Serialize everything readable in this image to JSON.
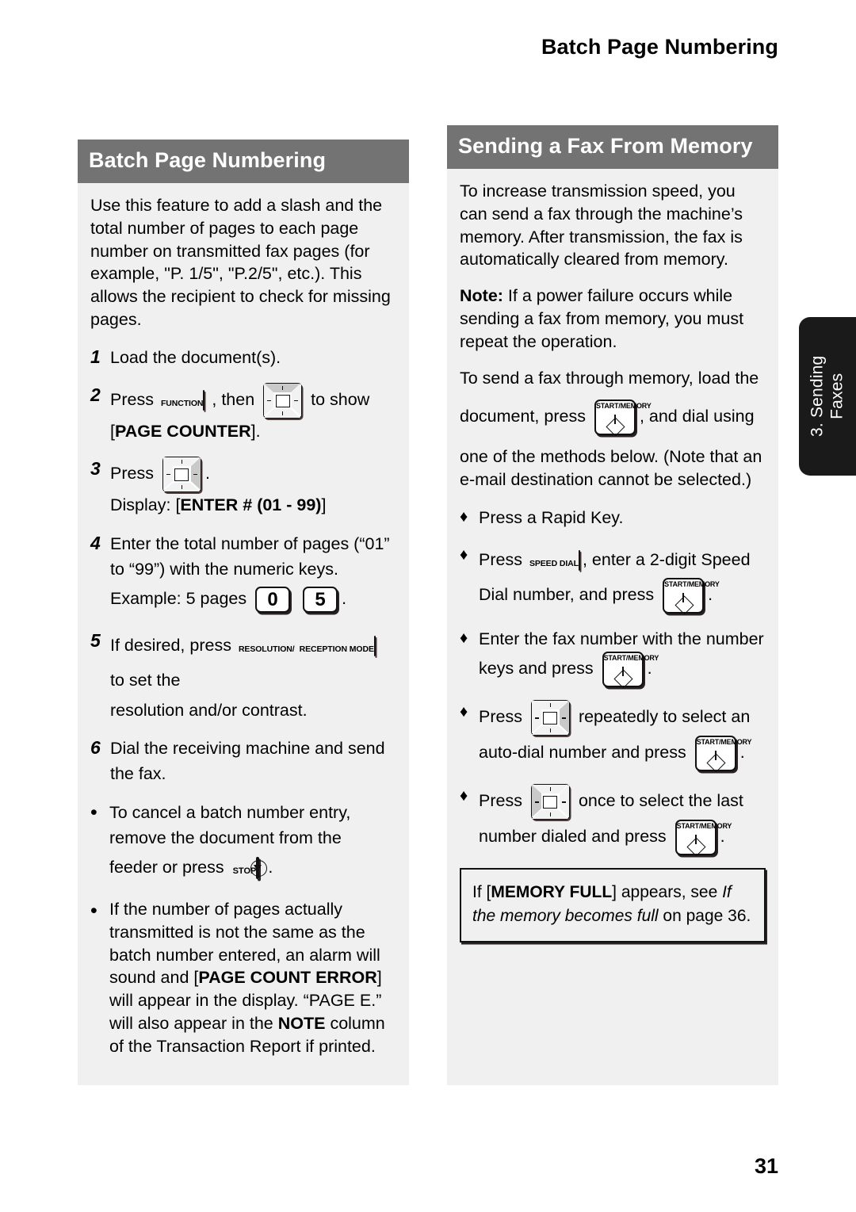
{
  "running_head": "Batch Page Numbering",
  "page_number": "31",
  "side_tab": {
    "line1": "3. Sending",
    "line2": "Faxes"
  },
  "left": {
    "heading": "Batch Page Numbering",
    "intro": "Use this feature to add a slash and the total number of pages to each page number on transmitted fax pages (for example, \"P. 1/5\", \"P.2/5\", etc.). This allows the recipient to check for missing pages.",
    "steps": [
      {
        "num": "1",
        "text": "Load the document(s)."
      },
      {
        "num": "2",
        "pre": "Press",
        "key1_cap": "FUNCTION",
        "mid": ", then",
        "key2": "up-arrow-key",
        "post": "to show",
        "line2_a": "[",
        "line2_b": "PAGE COUNTER",
        "line2_c": "]."
      },
      {
        "num": "3",
        "pre": "Press",
        "key": "right-arrow-key",
        "post": ".",
        "display_label": "Display: [",
        "display_bold": "ENTER # (01 - 99)",
        "display_end": "]"
      },
      {
        "num": "4",
        "text": "Enter the total number of pages (“01” to “99”) with the numeric keys.",
        "example_pre": "Example: 5 pages",
        "key_a": "0",
        "key_b": "5",
        "example_post": "."
      },
      {
        "num": "5",
        "pre": "If desired, press",
        "key_cap1": "RESOLUTION/",
        "key_cap2": "RECEPTION MODE",
        "post": "to set the",
        "line2": "resolution and/or contrast."
      },
      {
        "num": "6",
        "text": "Dial the receiving machine and send the fax."
      }
    ],
    "bullets": [
      {
        "mark": "•",
        "line1": "To cancel a batch number entry, remove the document from the",
        "line2_pre": "feeder or press",
        "key": "STOP",
        "line2_post": "."
      },
      {
        "mark": "•",
        "seg1": "If the number of pages actually transmitted is not the same as the batch number entered, an alarm will sound and [",
        "bold1": "PAGE COUNT ERROR",
        "seg2": "] will appear in the display. “PAGE E.” will also appear in the ",
        "bold2": "NOTE",
        "seg3": " column of the Transaction Report if printed."
      }
    ]
  },
  "right": {
    "heading": "Sending a Fax From Memory",
    "para1": "To increase transmission speed, you can send a fax through the machine’s memory. After transmission, the fax is automatically cleared from memory.",
    "note_label": "Note:",
    "note_text": " If a power failure occurs while sending a fax from memory, you must repeat the operation.",
    "para3_a": "To send a fax through memory, load the",
    "para3_b": "document, press",
    "para3_key": "START/MEMORY",
    "para3_c": ", and dial using",
    "para3_d": "one of the methods below. (Note that an e-mail destination cannot be selected.)",
    "bullets": [
      {
        "mark": "♦",
        "text": "Press a Rapid Key."
      },
      {
        "mark": "♦",
        "pre": "Press",
        "key_cap": "SPEED DIAL",
        "post": ", enter a 2-digit Speed",
        "line2_pre": "Dial number, and press",
        "key2": "START/MEMORY",
        "line2_post": "."
      },
      {
        "mark": "♦",
        "pre": "Enter the fax number with the number",
        "line2_pre": "keys  and press",
        "key2": "START/MEMORY",
        "line2_post": "."
      },
      {
        "mark": "♦",
        "pre": "Press",
        "key": "right-arrow-key",
        "post": "repeatedly to select an",
        "line2_pre": "auto-dial number and press",
        "key2": "START/MEMORY",
        "line2_post": "."
      },
      {
        "mark": "♦",
        "pre": "Press",
        "key": "left-arrow-key",
        "post": "once to select the last",
        "line2_pre": "number dialed and press",
        "key2": "START/MEMORY",
        "line2_post": "."
      }
    ],
    "callout": {
      "a": "If [",
      "bold": "MEMORY FULL",
      "b": "] appears, see ",
      "italic1": "If the memory becomes full",
      "c": " on page 36."
    }
  },
  "colors": {
    "panel_bg": "#f0f0f0",
    "panel_head_bg": "#737373",
    "side_tab_bg": "#1a1a1a",
    "text": "#000000"
  }
}
